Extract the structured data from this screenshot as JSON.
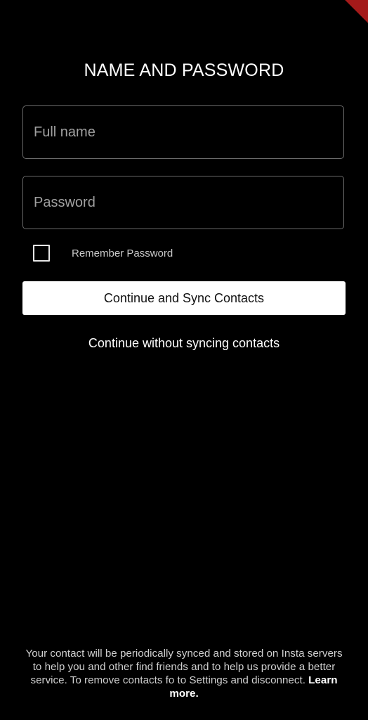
{
  "header": {
    "title": "NAME AND PASSWORD"
  },
  "form": {
    "fullname_placeholder": "Full name",
    "fullname_value": "",
    "password_placeholder": "Password",
    "password_value": "",
    "remember_label": "Remember Password",
    "remember_checked": false
  },
  "actions": {
    "sync_label": "Continue and Sync Contacts",
    "no_sync_label": "Continue without syncing contacts"
  },
  "footer": {
    "disclaimer": "Your contact will be periodically synced and stored on Insta servers to help you and other find friends and to help us provide a better service. To remove contacts fo to Settings and disconnect.",
    "learn_more": "Learn more."
  },
  "colors": {
    "background": "#000000",
    "primary_button": "#ffffff",
    "field_border": "#6b6b6b",
    "debug_ribbon": "#a41a1a"
  }
}
